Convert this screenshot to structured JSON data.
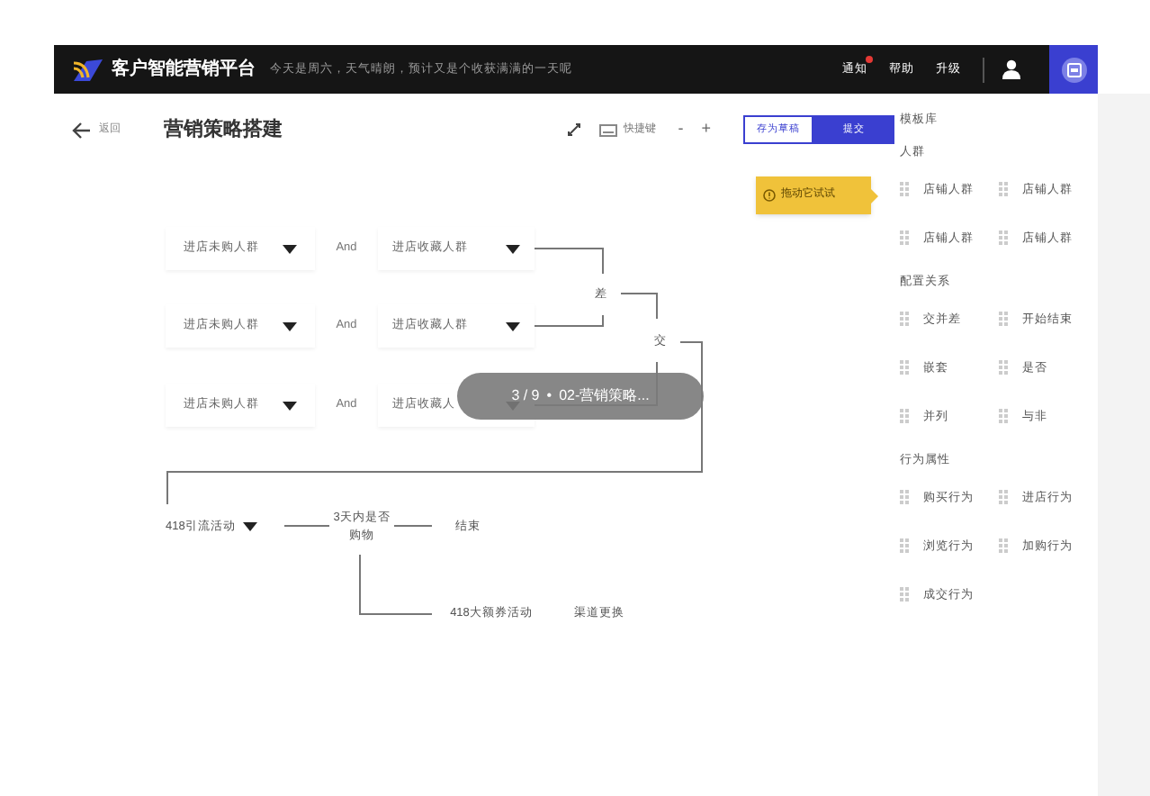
{
  "topbar": {
    "title": "客户智能营销平台",
    "tagline": "今天是周六，天气晴朗，预计又是个收获满满的一天呢",
    "nav": [
      {
        "label": "通知",
        "dot": true
      },
      {
        "label": "帮助",
        "dot": false
      },
      {
        "label": "升级",
        "dot": false
      }
    ]
  },
  "header": {
    "back": "返回",
    "title": "营销策略搭建",
    "shortcut": "快捷键",
    "zoom_out": "-",
    "zoom_in": "+",
    "save_draft": "存为草稿",
    "submit": "提交"
  },
  "hint": "拖动它试试",
  "canvas": {
    "rules": [
      {
        "left": "进店未购人群",
        "op": "And",
        "right": "进店收藏人群"
      },
      {
        "left": "进店未购人群",
        "op": "And",
        "right": "进店收藏人群"
      },
      {
        "left": "进店未购人群",
        "op": "And",
        "right": "进店收藏人"
      }
    ],
    "diff": "差",
    "intersect": "交",
    "activity": "418引流活动",
    "condition": "3天内是否购物",
    "end": "结束",
    "coupon": "418大额券活动",
    "channel": "渠道更换"
  },
  "overlay": {
    "counter": "3 / 9",
    "separator": "•",
    "title": "02-营销策略..."
  },
  "panel": {
    "title": "模板库",
    "sections": [
      {
        "title": "人群",
        "items": [
          "店铺人群",
          "店铺人群",
          "店铺人群",
          "店铺人群"
        ]
      },
      {
        "title": "配置关系",
        "items": [
          "交并差",
          "开始结束",
          "嵌套",
          "是否",
          "并列",
          "与非"
        ]
      },
      {
        "title": "行为属性",
        "items": [
          "购买行为",
          "进店行为",
          "浏览行为",
          "加购行为",
          "成交行为"
        ]
      }
    ]
  }
}
